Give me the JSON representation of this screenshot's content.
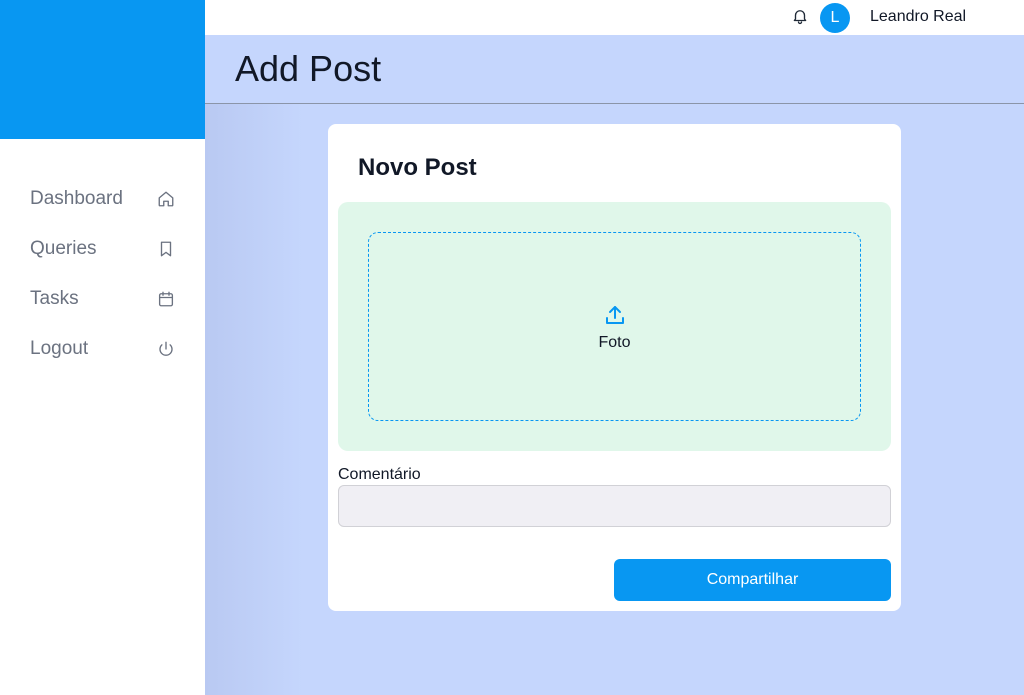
{
  "header": {
    "user_name": "Leandro Real",
    "avatar_initial": "L",
    "notification_icon": "bell-icon"
  },
  "sidebar": {
    "items": [
      {
        "label": "Dashboard",
        "icon": "home-icon"
      },
      {
        "label": "Queries",
        "icon": "bookmark-icon"
      },
      {
        "label": "Tasks",
        "icon": "calendar-icon"
      },
      {
        "label": "Logout",
        "icon": "power-icon"
      }
    ]
  },
  "page": {
    "title": "Add Post"
  },
  "form": {
    "title": "Novo Post",
    "upload_label": "Foto",
    "upload_icon": "upload-icon",
    "comment_label": "Comentário",
    "comment_value": "",
    "comment_placeholder": "",
    "submit_label": "Compartilhar"
  },
  "colors": {
    "primary": "#0897f2",
    "background": "#c5d6fd",
    "upload_area": "#e0f7ea",
    "input_bg": "#f0eff4"
  }
}
